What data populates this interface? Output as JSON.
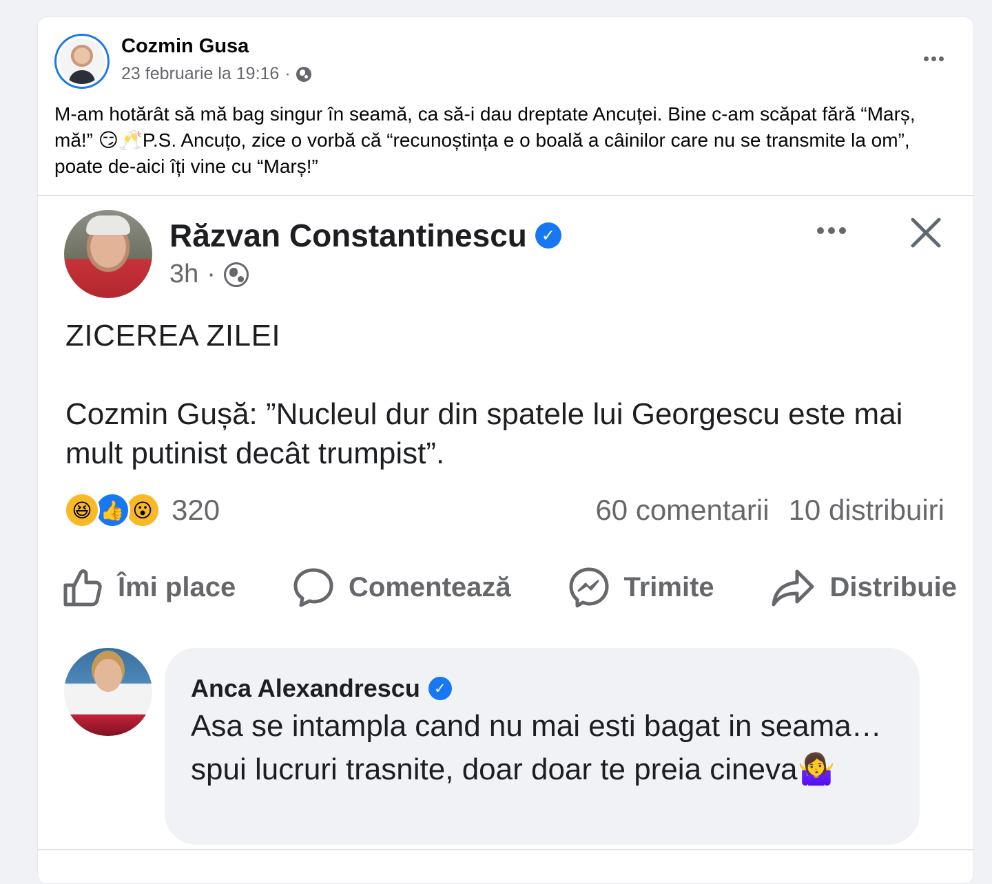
{
  "post": {
    "author": "Cozmin Gusa",
    "timestamp": "23 februarie la 19:16",
    "separator": "·",
    "privacy_icon": "globe-icon",
    "more_icon": "more-options-icon",
    "text": "M-am hotărât să mă bag singur în seamă, ca să-i dau dreptate Ancuței. Bine c-am scăpat fără “Marș, mă!” 😏🥂P.S. Ancuțo, zice o vorbă că “recunoștința e o boală a câinilor care nu se transmite la om”, poate de-aici îți vine cu “Marș!”"
  },
  "shared_post": {
    "author": "Răzvan Constantinescu",
    "verified_icon": "verified-badge-icon",
    "time": "3h",
    "separator": "·",
    "heading": "ZICEREA ZILEI",
    "body": "Cozmin Gușă: ”Nucleul dur din spatele lui Georgescu este mai mult putinist decât trumpist”.",
    "reaction_count": "320",
    "reactions": [
      "😆",
      "👍",
      "😮"
    ],
    "comments": "60 comentarii",
    "shares": "10 distribuiri",
    "actions": {
      "like": "Îmi place",
      "comment": "Comentează",
      "send": "Trimite",
      "share": "Distribuie"
    }
  },
  "comment": {
    "author": "Anca Alexandrescu",
    "text": "Asa se intampla cand nu mai esti bagat in seama… spui lucruri trasnite, doar doar te preia cineva🤷‍♀️"
  },
  "colors": {
    "accent": "#1877f2",
    "secondary_text": "#65676b",
    "bubble_bg": "#f0f2f5"
  }
}
